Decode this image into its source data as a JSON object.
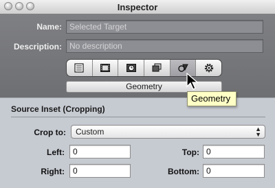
{
  "window": {
    "title": "Inspector"
  },
  "fields": {
    "name_label": "Name:",
    "name_value": "Selected Target",
    "description_label": "Description:",
    "description_value": "No description"
  },
  "tabs": {
    "items": [
      {
        "icon": "list-document-icon"
      },
      {
        "icon": "film-strip-icon"
      },
      {
        "icon": "clock-media-icon"
      },
      {
        "icon": "layers-icon"
      },
      {
        "icon": "geometry-shapes-icon",
        "selected": true
      },
      {
        "icon": "gear-icon"
      }
    ],
    "caption": "Geometry",
    "tooltip": "Geometry"
  },
  "section": {
    "title": "Source Inset (Cropping)",
    "crop_label": "Crop to:",
    "crop_value": "Custom",
    "left_label": "Left:",
    "left_value": "0",
    "top_label": "Top:",
    "top_value": "0",
    "right_label": "Right:",
    "right_value": "0",
    "bottom_label": "Bottom:",
    "bottom_value": "0"
  }
}
